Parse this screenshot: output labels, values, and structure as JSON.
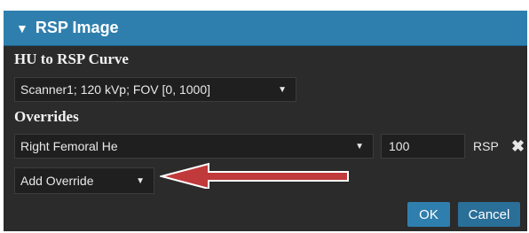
{
  "panel": {
    "title": "RSP Image",
    "collapse_icon": "caret-down-icon"
  },
  "hu_curve": {
    "label": "HU to RSP Curve",
    "selected": "Scanner1; 120 kVp; FOV [0, 1000]"
  },
  "overrides": {
    "label": "Overrides",
    "rows": [
      {
        "material": "Right Femoral He",
        "value": "100",
        "unit": "RSP",
        "remove_icon": "close-icon"
      }
    ],
    "add_selected": "Add Override"
  },
  "buttons": {
    "ok": "OK",
    "cancel": "Cancel"
  },
  "colors": {
    "header": "#2f7fae",
    "background": "#2b2b2b",
    "annotation_arrow": "#c0393b"
  }
}
